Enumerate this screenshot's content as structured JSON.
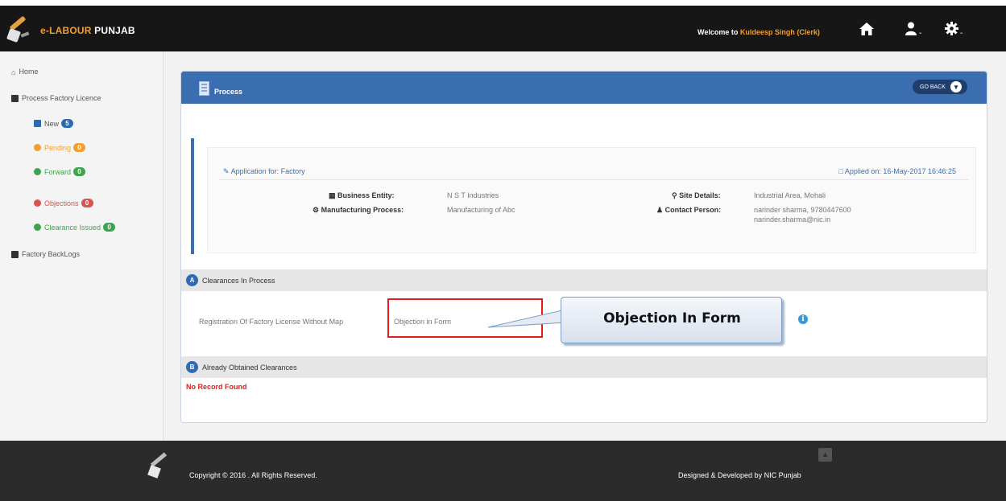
{
  "header": {
    "brand_e": "e-LABOUR",
    "brand_p": "PUNJAB",
    "welcome_prefix": "Welcome to",
    "welcome_user": "Kuldeesp Singh (Clerk)",
    "home_icon": "home-icon",
    "user_icon": "user-icon",
    "settings_icon": "gear-icon",
    "caret": "-"
  },
  "sidebar": {
    "home": "Home",
    "process_factory_licence": "Process Factory Licence",
    "items": [
      {
        "label": "New",
        "badge": "5",
        "color": "#2a6ab5"
      },
      {
        "label": "Pending",
        "badge": "0",
        "color": "#f0a030"
      },
      {
        "label": "Forward",
        "badge": "0",
        "color": "#3fa34d"
      },
      {
        "label": "Objections",
        "badge": "0",
        "color": "#d9534f"
      },
      {
        "label": "Clearance Issued",
        "badge": "0",
        "color": "#3fa34d"
      }
    ],
    "factory_backlogs": "Factory BackLogs"
  },
  "panel": {
    "title": "Process",
    "go_back": "GO BACK",
    "application_for": "Application for: Factory",
    "applied_on": "Applied on: 16-May-2017 16:46:25",
    "business_entity_label": "Business Entity:",
    "business_entity_value": "N S T Industries",
    "manufacturing_label": "Manufacturing Process:",
    "manufacturing_value": "Manufacturing of Abc",
    "site_details_label": "Site Details:",
    "site_details_value": "Industrial Area, Mohali",
    "contact_person_label": "Contact Person:",
    "contact_line1": "narinder sharma, 9780447600",
    "contact_line2": "narinder.sharma@nic.in"
  },
  "clearances": {
    "section_a_letter": "A",
    "section_a_title": "Clearances In Process",
    "row_name": "Registration Of Factory License Without Map",
    "row_status": "Objection in Form",
    "info": "i",
    "section_b_letter": "B",
    "section_b_title": "Already Obtained Clearances",
    "no_record": "No Record Found"
  },
  "annotation": {
    "callout_text": "Objection In Form",
    "box_color": "#e41b1b"
  },
  "footer": {
    "copyright": "Copyright © 2016 . All Rights Reserved.",
    "designed": "Designed & Developed by NIC Punjab",
    "to_top": "▲"
  }
}
